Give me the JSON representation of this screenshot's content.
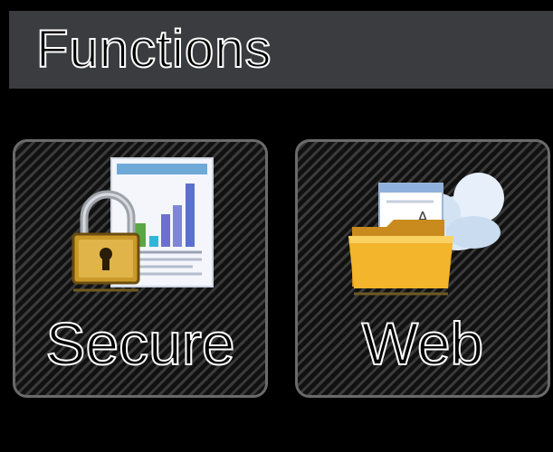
{
  "header": {
    "title": "Functions"
  },
  "tiles": [
    {
      "label": "Secure",
      "icon": "lock-document-icon"
    },
    {
      "label": "Web",
      "icon": "folder-cloud-icon"
    }
  ],
  "colors": {
    "header_bg": "#3b3c40",
    "background": "#000000",
    "tile_border": "#6a6a6a",
    "text": "#ffffff"
  }
}
